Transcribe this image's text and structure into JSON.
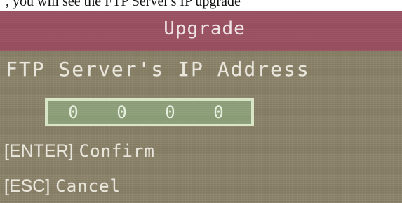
{
  "caption": ", you will see the FTP Server's IP upgrade",
  "dialog": {
    "title": "Upgrade",
    "field_label": "FTP Server's IP Address",
    "ip_octets": [
      "0",
      "0",
      "0",
      "0"
    ],
    "hints": [
      {
        "key": "[ENTER]",
        "action": "Confirm"
      },
      {
        "key": "[ESC]",
        "action": "Cancel"
      }
    ]
  },
  "colors": {
    "background": "#8a8167",
    "title_bar": "#9b5060",
    "text": "#e9e6dc",
    "ip_box_fill": "#8ea17a",
    "ip_box_border": "#d8e6c6"
  }
}
